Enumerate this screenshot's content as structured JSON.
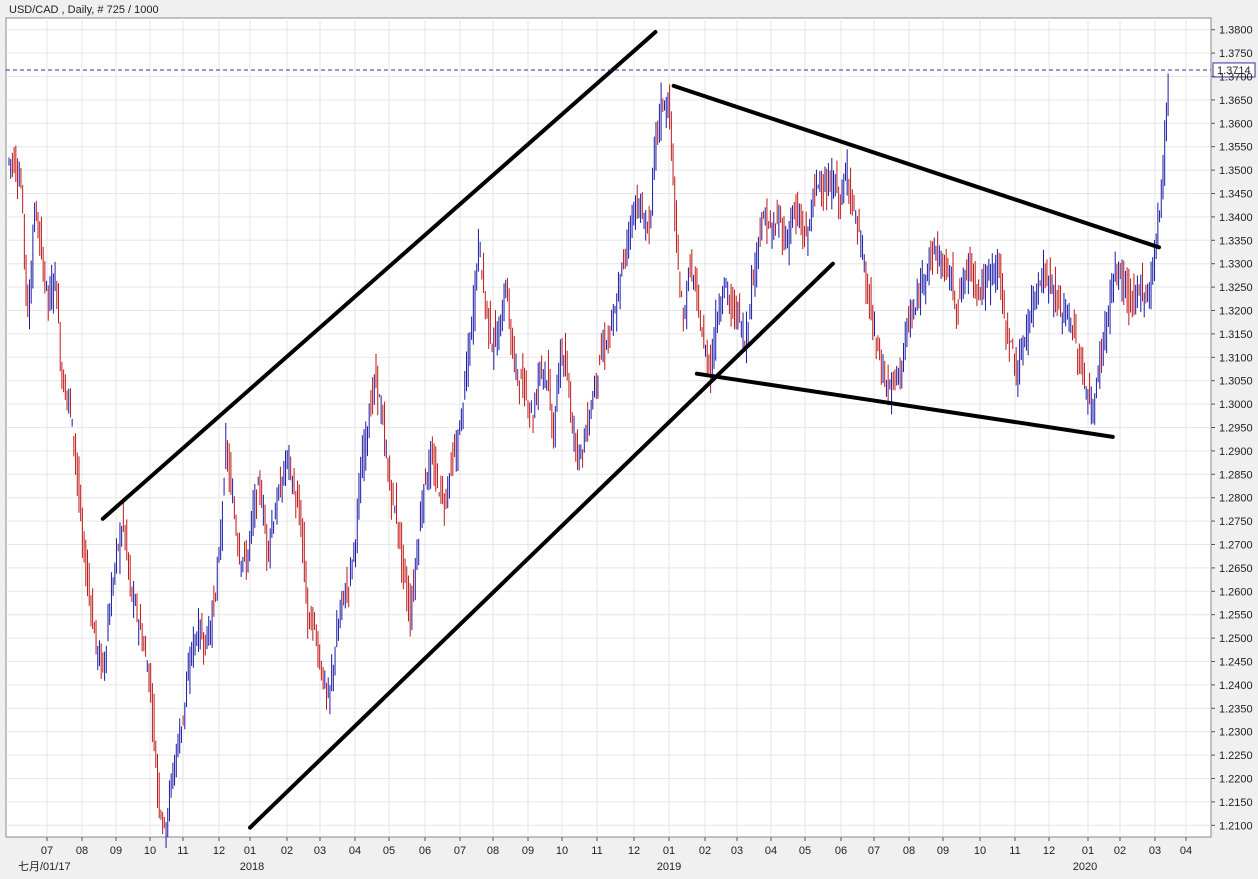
{
  "chart_data": {
    "type": "candlestick",
    "title": "USD/CAD , Daily, # 725 / 1000",
    "symbol": "USD/CAD",
    "timeframe": "Daily",
    "bar_count": "# 725 / 1000",
    "current_price": "1.3714",
    "y_axis": {
      "min": 1.2075,
      "max": 1.3825,
      "ticks": [
        "1.2100",
        "1.2150",
        "1.2200",
        "1.2250",
        "1.2300",
        "1.2350",
        "1.2400",
        "1.2450",
        "1.2500",
        "1.2550",
        "1.2600",
        "1.2650",
        "1.2700",
        "1.2750",
        "1.2800",
        "1.2850",
        "1.2900",
        "1.2950",
        "1.3000",
        "1.3050",
        "1.3100",
        "1.3150",
        "1.3200",
        "1.3250",
        "1.3300",
        "1.3350",
        "1.3400",
        "1.3450",
        "1.3500",
        "1.3550",
        "1.3600",
        "1.3650",
        "1.3700",
        "1.3750",
        "1.3800"
      ]
    },
    "x_axis": {
      "start_label": "七月/01/17",
      "month_ticks": [
        "07",
        "08",
        "09",
        "10",
        "11",
        "12",
        "01",
        "02",
        "03",
        "04",
        "05",
        "06",
        "07",
        "08",
        "09",
        "10",
        "11",
        "12",
        "01",
        "02",
        "03",
        "04",
        "05",
        "06",
        "07",
        "08",
        "09",
        "10",
        "11",
        "12",
        "01",
        "02",
        "03",
        "04"
      ],
      "year_labels": [
        "2018",
        "2019",
        "2020"
      ]
    },
    "series": [
      {
        "name": "",
        "points": [
          [
            0,
            1.352
          ],
          [
            1,
            1.347
          ],
          [
            2,
            1.318
          ],
          [
            3,
            1.342
          ],
          [
            4,
            1.332
          ],
          [
            5,
            1.322
          ],
          [
            6,
            1.328
          ],
          [
            7,
            1.305
          ],
          [
            8,
            1.301
          ],
          [
            9,
            1.289
          ],
          [
            10,
            1.27
          ],
          [
            11,
            1.26
          ],
          [
            12,
            1.248
          ],
          [
            13,
            1.243
          ],
          [
            14,
            1.257
          ],
          [
            15,
            1.268
          ],
          [
            16,
            1.275
          ],
          [
            17,
            1.26
          ],
          [
            18,
            1.255
          ],
          [
            19,
            1.248
          ],
          [
            20,
            1.239
          ],
          [
            21,
            1.218
          ],
          [
            22,
            1.209
          ],
          [
            23,
            1.219
          ],
          [
            24,
            1.228
          ],
          [
            25,
            1.236
          ],
          [
            26,
            1.248
          ],
          [
            27,
            1.252
          ],
          [
            28,
            1.249
          ],
          [
            29,
            1.255
          ],
          [
            30,
            1.267
          ],
          [
            31,
            1.291
          ],
          [
            32,
            1.279
          ],
          [
            33,
            1.268
          ],
          [
            34,
            1.266
          ],
          [
            35,
            1.277
          ],
          [
            36,
            1.283
          ],
          [
            37,
            1.269
          ],
          [
            38,
            1.276
          ],
          [
            39,
            1.282
          ],
          [
            40,
            1.289
          ],
          [
            41,
            1.281
          ],
          [
            42,
            1.274
          ],
          [
            43,
            1.254
          ],
          [
            44,
            1.252
          ],
          [
            45,
            1.243
          ],
          [
            46,
            1.236
          ],
          [
            47,
            1.248
          ],
          [
            48,
            1.258
          ],
          [
            49,
            1.262
          ],
          [
            50,
            1.272
          ],
          [
            51,
            1.289
          ],
          [
            52,
            1.298
          ],
          [
            53,
            1.306
          ],
          [
            54,
            1.295
          ],
          [
            55,
            1.282
          ],
          [
            56,
            1.276
          ],
          [
            57,
            1.264
          ],
          [
            58,
            1.255
          ],
          [
            59,
            1.269
          ],
          [
            60,
            1.283
          ],
          [
            61,
            1.288
          ],
          [
            62,
            1.283
          ],
          [
            63,
            1.279
          ],
          [
            64,
            1.287
          ],
          [
            65,
            1.292
          ],
          [
            66,
            1.304
          ],
          [
            67,
            1.317
          ],
          [
            68,
            1.335
          ],
          [
            69,
            1.321
          ],
          [
            70,
            1.313
          ],
          [
            71,
            1.315
          ],
          [
            72,
            1.326
          ],
          [
            73,
            1.31
          ],
          [
            74,
            1.305
          ],
          [
            75,
            1.302
          ],
          [
            76,
            1.297
          ],
          [
            77,
            1.309
          ],
          [
            78,
            1.306
          ],
          [
            79,
            1.293
          ],
          [
            80,
            1.312
          ],
          [
            81,
            1.305
          ],
          [
            82,
            1.293
          ],
          [
            83,
            1.289
          ],
          [
            84,
            1.296
          ],
          [
            85,
            1.304
          ],
          [
            86,
            1.311
          ],
          [
            87,
            1.314
          ],
          [
            88,
            1.319
          ],
          [
            89,
            1.329
          ],
          [
            90,
            1.337
          ],
          [
            91,
            1.343
          ],
          [
            92,
            1.34
          ],
          [
            93,
            1.337
          ],
          [
            94,
            1.358
          ],
          [
            95,
            1.365
          ],
          [
            96,
            1.362
          ],
          [
            97,
            1.332
          ],
          [
            98,
            1.318
          ],
          [
            99,
            1.33
          ],
          [
            100,
            1.322
          ],
          [
            101,
            1.312
          ],
          [
            102,
            1.308
          ],
          [
            103,
            1.32
          ],
          [
            104,
            1.326
          ],
          [
            105,
            1.32
          ],
          [
            106,
            1.32
          ],
          [
            107,
            1.313
          ],
          [
            108,
            1.325
          ],
          [
            109,
            1.336
          ],
          [
            110,
            1.34
          ],
          [
            111,
            1.336
          ],
          [
            112,
            1.34
          ],
          [
            113,
            1.334
          ],
          [
            114,
            1.341
          ],
          [
            115,
            1.339
          ],
          [
            116,
            1.335
          ],
          [
            117,
            1.344
          ],
          [
            118,
            1.349
          ],
          [
            119,
            1.345
          ],
          [
            120,
            1.348
          ],
          [
            121,
            1.343
          ],
          [
            122,
            1.35
          ],
          [
            123,
            1.341
          ],
          [
            124,
            1.334
          ],
          [
            125,
            1.323
          ],
          [
            126,
            1.315
          ],
          [
            127,
            1.308
          ],
          [
            128,
            1.303
          ],
          [
            129,
            1.305
          ],
          [
            130,
            1.309
          ],
          [
            131,
            1.318
          ],
          [
            132,
            1.32
          ],
          [
            133,
            1.327
          ],
          [
            134,
            1.331
          ],
          [
            135,
            1.333
          ],
          [
            136,
            1.329
          ],
          [
            137,
            1.328
          ],
          [
            138,
            1.321
          ],
          [
            139,
            1.326
          ],
          [
            140,
            1.33
          ],
          [
            141,
            1.325
          ],
          [
            142,
            1.325
          ],
          [
            143,
            1.328
          ],
          [
            144,
            1.331
          ],
          [
            145,
            1.318
          ],
          [
            146,
            1.312
          ],
          [
            147,
            1.306
          ],
          [
            148,
            1.315
          ],
          [
            149,
            1.32
          ],
          [
            150,
            1.327
          ],
          [
            151,
            1.328
          ],
          [
            152,
            1.325
          ],
          [
            153,
            1.32
          ],
          [
            154,
            1.32
          ],
          [
            155,
            1.316
          ],
          [
            156,
            1.309
          ],
          [
            157,
            1.303
          ],
          [
            158,
            1.298
          ],
          [
            159,
            1.31
          ],
          [
            160,
            1.318
          ],
          [
            161,
            1.327
          ],
          [
            162,
            1.328
          ],
          [
            163,
            1.323
          ],
          [
            164,
            1.321
          ],
          [
            165,
            1.326
          ],
          [
            166,
            1.322
          ],
          [
            167,
            1.333
          ],
          [
            168,
            1.345
          ],
          [
            169,
            1.371
          ]
        ]
      }
    ],
    "trendlines": [
      {
        "name": "upper-channel",
        "from": [
          "2017-08-20",
          1.2755
        ],
        "to": [
          "2018-12-20",
          1.3795
        ]
      },
      {
        "name": "lower-channel",
        "from": [
          "2018-01-01",
          1.2095
        ],
        "to": [
          "2019-05-25",
          1.33
        ]
      },
      {
        "name": "resistance",
        "from": [
          "2019-01-05",
          1.368
        ],
        "to": [
          "2020-03-05",
          1.3335
        ]
      },
      {
        "name": "support",
        "from": [
          "2019-01-25",
          1.3065
        ],
        "to": [
          "2020-01-25",
          1.293
        ]
      }
    ],
    "colors": {
      "background": "#ffffff",
      "frame": "#f0f0f0",
      "grid": "#e6e6e6",
      "up": "#1a1aa8",
      "down": "#c01818",
      "trendline": "#000000",
      "price_line": "#3030a0"
    },
    "grid": true
  }
}
